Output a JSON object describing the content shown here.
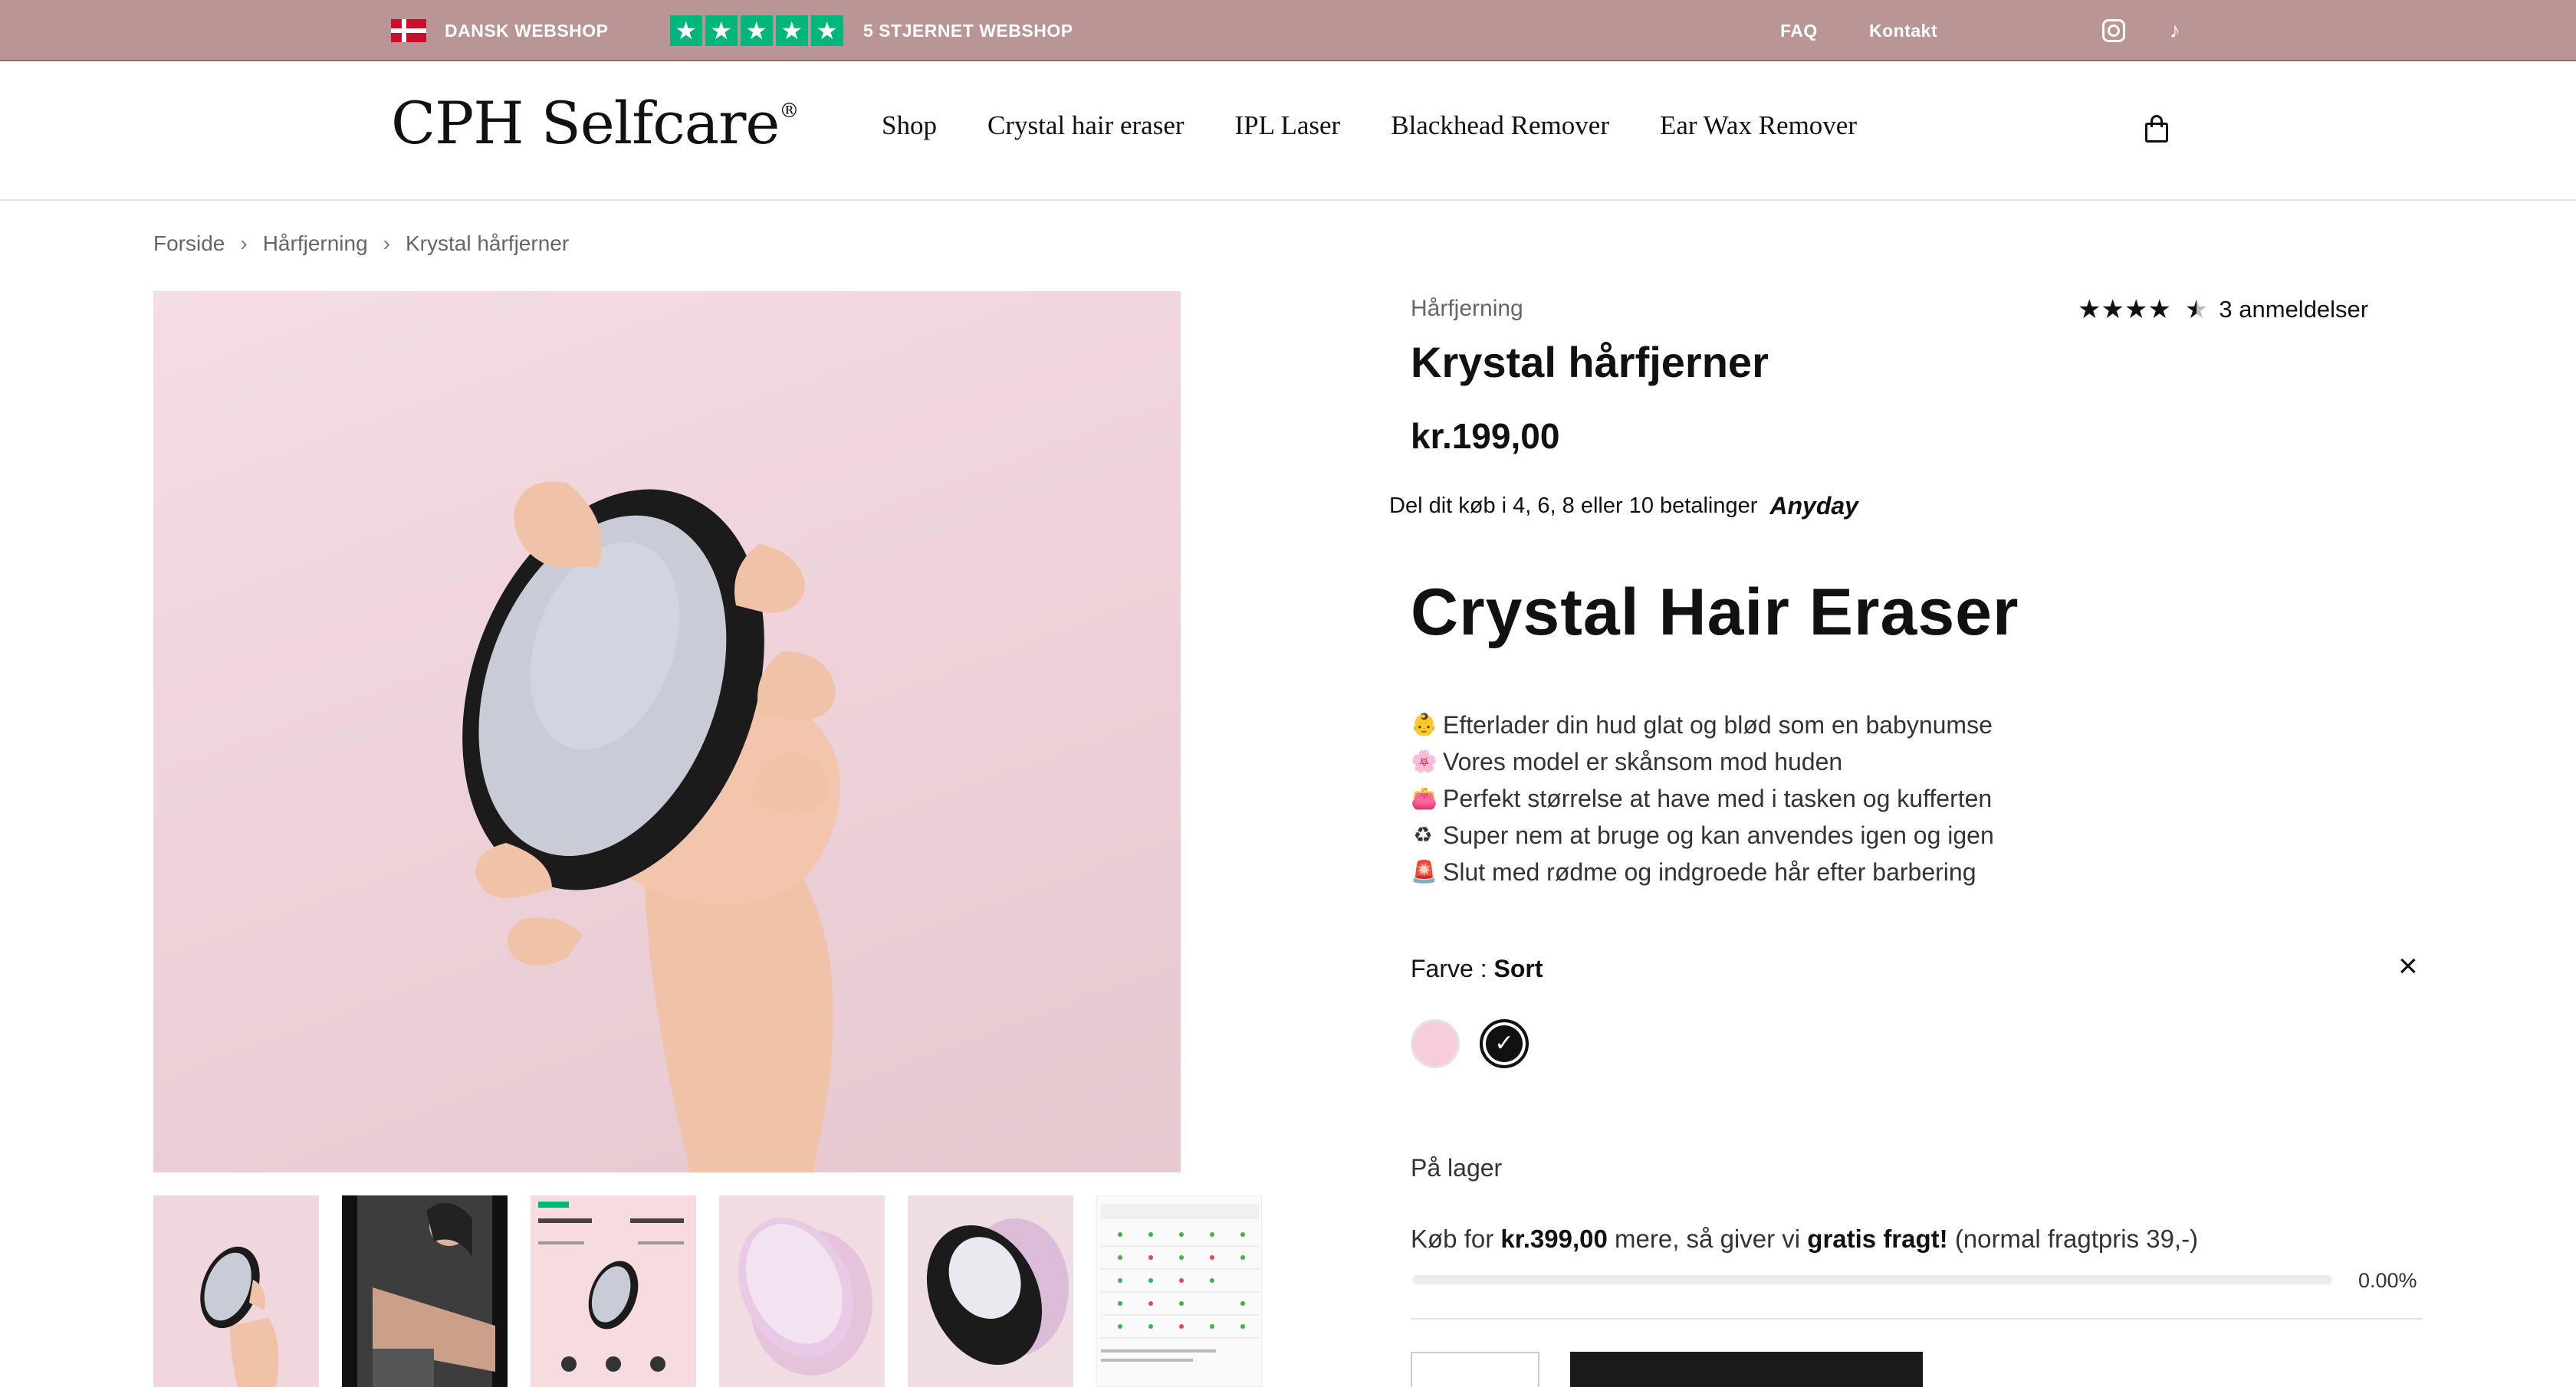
{
  "topbar": {
    "left_label": "DANSK WEBSHOP",
    "rating_label": "5 STJERNET WEBSHOP",
    "faq": "FAQ",
    "contact": "Kontakt"
  },
  "header": {
    "logo": "CPH Selfcare",
    "logo_mark": "®",
    "nav": [
      "Shop",
      "Crystal hair eraser",
      "IPL Laser",
      "Blackhead Remover",
      "Ear Wax Remover"
    ]
  },
  "breadcrumb": [
    "Forside",
    "Hårfjerning",
    "Krystal hårfjerner"
  ],
  "product": {
    "category": "Hårfjerning",
    "title": "Krystal hårfjerner",
    "price": "kr.199,00",
    "reviews": "3 anmeldelser",
    "rating": 4.5,
    "anyday_text": "Del dit køb i 4, 6, 8 eller 10 betalinger",
    "anyday_brand": "Anyday",
    "heading": "Crystal Hair Eraser",
    "bullets": [
      "Efterlader din hud glat og blød som en babynumse",
      "Vores model er skånsom mod huden",
      "Perfekt størrelse at have med i tasken og kufferten",
      "Super nem at bruge og kan anvendes igen og igen",
      "Slut med rødme og indgroede hår efter barbering"
    ],
    "color_label": "Farve :",
    "color_value": "Sort",
    "swatches": [
      {
        "name": "pink",
        "color": "#f7ccdc"
      },
      {
        "name": "black",
        "color": "#111111",
        "selected": true
      }
    ],
    "stock": "På lager",
    "free_shipping": {
      "prefix": "Køb for",
      "amount": "kr.399,00",
      "middle": "mere, så giver vi",
      "bold": "gratis fragt!",
      "suffix": "(normal fragtpris 39,-)",
      "progress_label": "0.00%",
      "progress": 0.0
    }
  },
  "colors": {
    "topbar": "#b99595",
    "trustpilot": "#00b67a"
  }
}
